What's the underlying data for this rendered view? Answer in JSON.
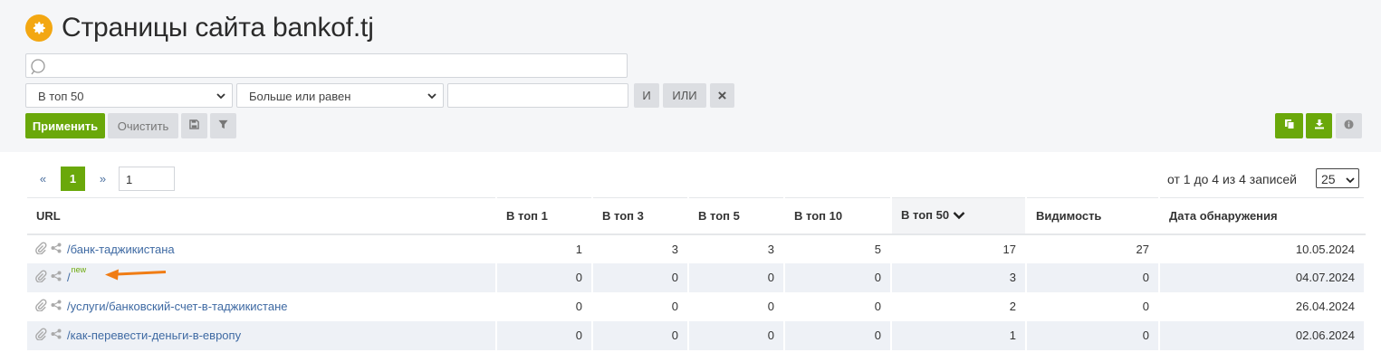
{
  "page": {
    "title": "Страницы сайта bankof.tj"
  },
  "filter": {
    "search_placeholder": "",
    "field_select": "В топ 50",
    "operator_select": "Больше или равен",
    "value": "",
    "and_label": "И",
    "or_label": "ИЛИ",
    "apply_label": "Применить",
    "clear_label": "Очистить"
  },
  "pagination": {
    "prev": "«",
    "current": "1",
    "next": "»",
    "goto_value": "1",
    "records_text": "от 1 до 4 из 4 записей",
    "per_page": "25"
  },
  "table": {
    "columns": [
      "URL",
      "В топ 1",
      "В топ 3",
      "В топ 5",
      "В топ 10",
      "В топ 50",
      "Видимость",
      "Дата обнаружения"
    ],
    "rows": [
      {
        "url": "/банк-таджикистана",
        "new": "",
        "top1": "1",
        "top3": "3",
        "top5": "3",
        "top10": "5",
        "top50": "17",
        "visibility": "27",
        "date": "10.05.2024"
      },
      {
        "url": "/",
        "new": "new",
        "top1": "0",
        "top3": "0",
        "top5": "0",
        "top10": "0",
        "top50": "3",
        "visibility": "0",
        "date": "04.07.2024"
      },
      {
        "url": "/услуги/банковский-счет-в-таджикистане",
        "new": "",
        "top1": "0",
        "top3": "0",
        "top5": "0",
        "top10": "0",
        "top50": "2",
        "visibility": "0",
        "date": "26.04.2024"
      },
      {
        "url": "/как-перевести-деньги-в-европу",
        "new": "",
        "top1": "0",
        "top3": "0",
        "top5": "0",
        "top10": "0",
        "top50": "1",
        "visibility": "0",
        "date": "02.06.2024"
      }
    ]
  },
  "colors": {
    "accent_green": "#6aa80a",
    "gear_orange": "#f3a712",
    "link_blue": "#3f6aa3",
    "arrow_orange": "#f07c14"
  },
  "icons": [
    "gear-icon",
    "search-icon",
    "chevron-down-icon",
    "close-icon",
    "save-icon",
    "filter-icon",
    "copy-icon",
    "download-icon",
    "info-icon",
    "paperclip-icon",
    "share-icon",
    "sort-desc-icon",
    "arrow-annotation-icon"
  ]
}
